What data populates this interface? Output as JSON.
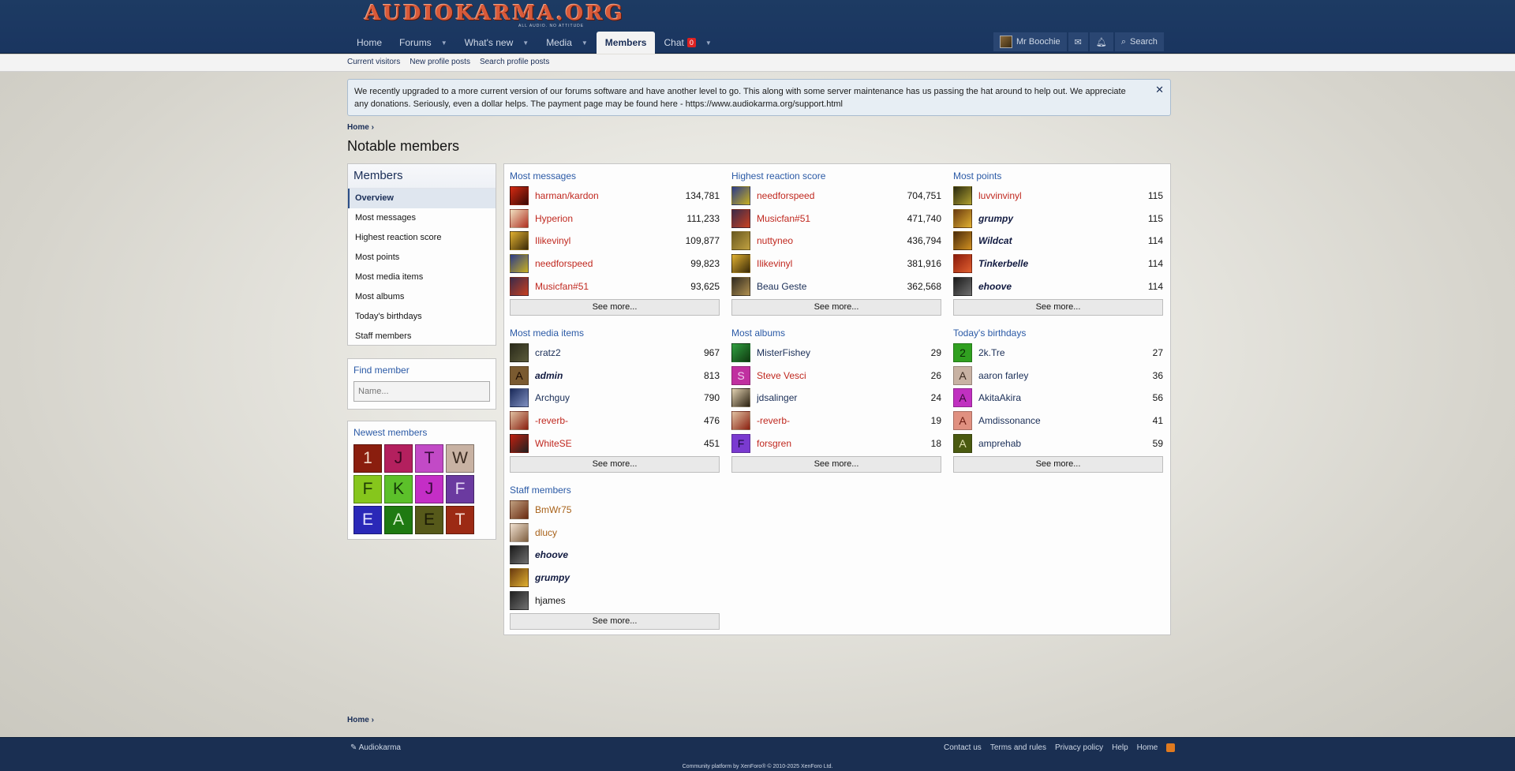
{
  "site": {
    "logo_text": "AUDIOKARMA.ORG",
    "logo_tagline": "ALL AUDIO. NO ATTITUDE"
  },
  "nav": {
    "items": [
      {
        "label": "Home"
      },
      {
        "label": "Forums"
      },
      {
        "label": "What's new"
      },
      {
        "label": "Media"
      },
      {
        "label": "Members"
      },
      {
        "label": "Chat"
      }
    ],
    "chat_count": "0",
    "user": "Mr Boochie",
    "search": "Search"
  },
  "subnav": [
    "Current visitors",
    "New profile posts",
    "Search profile posts"
  ],
  "notice": "We recently upgraded to a more current version of our forums software and have another level to go. This along with some server maintenance has us passing the hat around to help out. We appreciate any donations. Seriously, even a dollar helps. The payment page may be found here - https://www.audiokarma.org/support.html",
  "breadcrumb": "Home",
  "page_title": "Notable members",
  "sidebar": {
    "title": "Members",
    "items": [
      "Overview",
      "Most messages",
      "Highest reaction score",
      "Most points",
      "Most media items",
      "Most albums",
      "Today's birthdays",
      "Staff members"
    ]
  },
  "find_member": {
    "title": "Find member",
    "placeholder": "Name..."
  },
  "newest_members": {
    "title": "Newest members",
    "tiles": [
      {
        "letter": "1",
        "bg": "#8a1e0e",
        "fg": "#f0d8c8"
      },
      {
        "letter": "J",
        "bg": "#b3205e",
        "fg": "#3a0620"
      },
      {
        "letter": "T",
        "bg": "#c24ac6",
        "fg": "#3c0d40"
      },
      {
        "letter": "W",
        "bg": "#c8b2a3",
        "fg": "#3a2a20"
      },
      {
        "letter": "F",
        "bg": "#86c61c",
        "fg": "#1e3a05"
      },
      {
        "letter": "K",
        "bg": "#5cc02a",
        "fg": "#143a08"
      },
      {
        "letter": "J",
        "bg": "#c42ec6",
        "fg": "#3a0a3c"
      },
      {
        "letter": "F",
        "bg": "#6b3aa0",
        "fg": "#e6d8f5"
      },
      {
        "letter": "E",
        "bg": "#2a28b8",
        "fg": "#e4e4ff"
      },
      {
        "letter": "A",
        "bg": "#1f7a12",
        "fg": "#d6f0cc"
      },
      {
        "letter": "E",
        "bg": "#56591a",
        "fg": "#1a1a05"
      },
      {
        "letter": "T",
        "bg": "#9c2a14",
        "fg": "#f6dcd2"
      }
    ]
  },
  "sections": {
    "most_messages": {
      "title": "Most messages",
      "rows": [
        {
          "name": "harman/kardon",
          "value": "134,781"
        },
        {
          "name": "Hyperion",
          "value": "111,233"
        },
        {
          "name": "Ilikevinyl",
          "value": "109,877"
        },
        {
          "name": "needforspeed",
          "value": "99,823"
        },
        {
          "name": "Musicfan#51",
          "value": "93,625"
        }
      ]
    },
    "highest_reaction": {
      "title": "Highest reaction score",
      "rows": [
        {
          "name": "needforspeed",
          "value": "704,751"
        },
        {
          "name": "Musicfan#51",
          "value": "471,740"
        },
        {
          "name": "nuttyneo",
          "value": "436,794"
        },
        {
          "name": "Ilikevinyl",
          "value": "381,916"
        },
        {
          "name": "Beau Geste",
          "value": "362,568"
        }
      ]
    },
    "most_points": {
      "title": "Most points",
      "rows": [
        {
          "name": "luvvinvinyl",
          "value": "115"
        },
        {
          "name": "grumpy",
          "value": "115"
        },
        {
          "name": "Wildcat",
          "value": "114"
        },
        {
          "name": "Tinkerbelle",
          "value": "114"
        },
        {
          "name": "ehoove",
          "value": "114"
        }
      ]
    },
    "most_media": {
      "title": "Most media items",
      "rows": [
        {
          "name": "cratz2",
          "value": "967"
        },
        {
          "name": "admin",
          "value": "813"
        },
        {
          "name": "Archguy",
          "value": "790"
        },
        {
          "name": "-reverb-",
          "value": "476"
        },
        {
          "name": "WhiteSE",
          "value": "451"
        }
      ]
    },
    "most_albums": {
      "title": "Most albums",
      "rows": [
        {
          "name": "MisterFishey",
          "value": "29"
        },
        {
          "name": "Steve Vesci",
          "value": "26"
        },
        {
          "name": "jdsalinger",
          "value": "24"
        },
        {
          "name": "-reverb-",
          "value": "19"
        },
        {
          "name": "forsgren",
          "value": "18"
        }
      ]
    },
    "birthdays": {
      "title": "Today's birthdays",
      "rows": [
        {
          "name": "2k.Tre",
          "value": "27"
        },
        {
          "name": "aaron farley",
          "value": "36"
        },
        {
          "name": "AkitaAkira",
          "value": "56"
        },
        {
          "name": "Amdissonance",
          "value": "41"
        },
        {
          "name": "amprehab",
          "value": "59"
        }
      ]
    },
    "staff": {
      "title": "Staff members",
      "rows": [
        {
          "name": "BmWr75"
        },
        {
          "name": "dlucy"
        },
        {
          "name": "ehoove"
        },
        {
          "name": "grumpy"
        },
        {
          "name": "hjames"
        }
      ]
    },
    "see_more": "See more..."
  },
  "avatar_letters": {
    "admin": "A",
    "forsgren": "F",
    "Steve Vesci": "S",
    "2k.Tre": "2",
    "aaron farley": "A",
    "AkitaAkira": "A",
    "Amdissonance": "A",
    "amprehab": "A"
  },
  "footer": {
    "brand": "Audiokarma",
    "links": [
      "Contact us",
      "Terms and rules",
      "Privacy policy",
      "Help",
      "Home"
    ],
    "copyright": "Community platform by XenForo® © 2010-2025 XenForo Ltd."
  }
}
